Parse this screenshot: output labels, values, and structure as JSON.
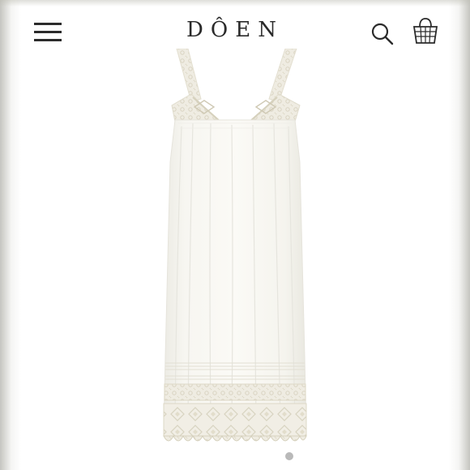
{
  "header": {
    "brand": "DÔEN",
    "menu_icon": "hamburger-menu-icon",
    "search_icon": "search-icon",
    "cart_icon": "shopping-basket-icon"
  },
  "product": {
    "image_description_icon": "white-crochet-slip-dress-image"
  },
  "carousel": {
    "dot_count": 1,
    "active_index": 0
  },
  "colors": {
    "background": "#ffffff",
    "icon": "#2b2b2b",
    "dress": "#f5f4ee",
    "lace": "#ebe8dc",
    "dot": "#b9b9b9"
  }
}
